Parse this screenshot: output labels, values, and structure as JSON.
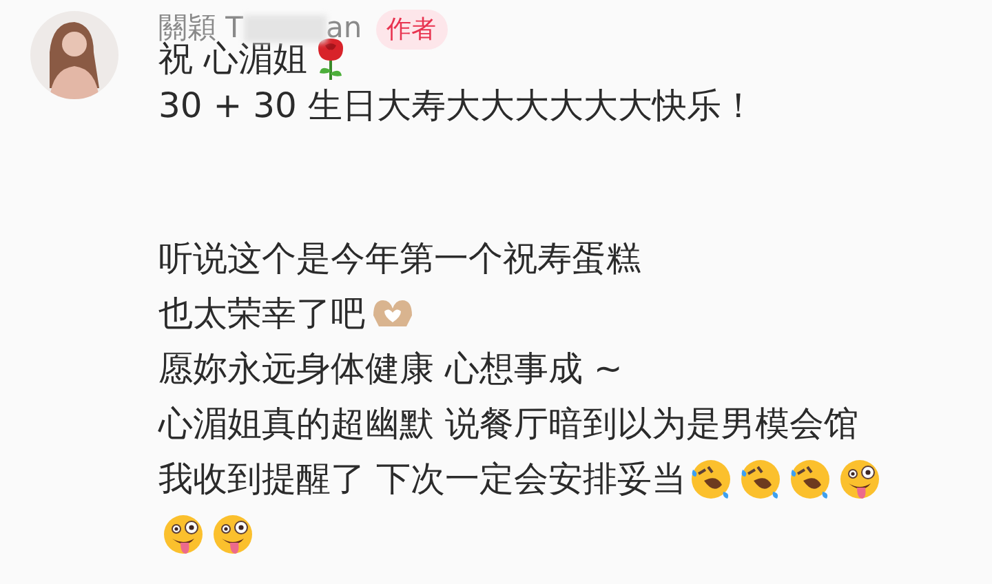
{
  "comment": {
    "author": {
      "name": "關穎 T",
      "name_end": "an",
      "badge": "作者"
    },
    "paragraphs": [
      {
        "lines": [
          {
            "text": "祝 心湄姐",
            "emojis": [
              {
                "kind": "rose"
              }
            ]
          },
          {
            "text": "30 + 30 生日大寿大大大大大大快乐！"
          }
        ]
      },
      {
        "lines": [
          {
            "text": "听说这个是今年第一个祝寿蛋糕"
          },
          {
            "text": "也太荣幸了吧",
            "emojis": [
              {
                "kind": "heart-hands"
              }
            ]
          },
          {
            "text": "愿妳永远身体健康 心想事成 ~"
          },
          {
            "text": "心湄姐真的超幽默 说餐厅暗到以为是男模会馆"
          },
          {
            "text": "我收到提醒了 下次一定会安排妥当",
            "emojis": [
              {
                "kind": "rofl"
              },
              {
                "kind": "rofl"
              },
              {
                "kind": "rofl"
              },
              {
                "kind": "zany"
              }
            ]
          },
          {
            "emojis": [
              {
                "kind": "zany"
              },
              {
                "kind": "zany"
              }
            ]
          }
        ]
      }
    ]
  }
}
